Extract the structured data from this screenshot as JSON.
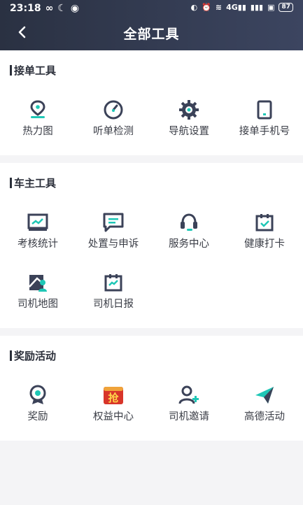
{
  "status_bar": {
    "time": "23:18",
    "battery": "87",
    "network": "4G"
  },
  "header": {
    "title": "全部工具"
  },
  "sections": [
    {
      "title": "接单工具",
      "items": [
        {
          "label": "热力图",
          "icon": "map-pin-icon"
        },
        {
          "label": "听单检测",
          "icon": "gauge-icon"
        },
        {
          "label": "导航设置",
          "icon": "gear-icon"
        },
        {
          "label": "接单手机号",
          "icon": "phone-icon"
        }
      ]
    },
    {
      "title": "车主工具",
      "items": [
        {
          "label": "考核统计",
          "icon": "chart-icon"
        },
        {
          "label": "处置与申诉",
          "icon": "message-icon"
        },
        {
          "label": "服务中心",
          "icon": "headset-icon"
        },
        {
          "label": "健康打卡",
          "icon": "calendar-check-icon"
        },
        {
          "label": "司机地图",
          "icon": "driver-map-icon"
        },
        {
          "label": "司机日报",
          "icon": "daily-report-icon"
        }
      ]
    },
    {
      "title": "奖励活动",
      "items": [
        {
          "label": "奖励",
          "icon": "medal-icon"
        },
        {
          "label": "权益中心",
          "icon": "rights-badge-icon",
          "badge_text": "抢"
        },
        {
          "label": "司机邀请",
          "icon": "add-user-icon"
        },
        {
          "label": "高德活动",
          "icon": "paper-plane-icon"
        }
      ]
    }
  ],
  "colors": {
    "accent": "#1fc7b6",
    "dark": "#3b4258",
    "header_bg": "#2f364b"
  }
}
